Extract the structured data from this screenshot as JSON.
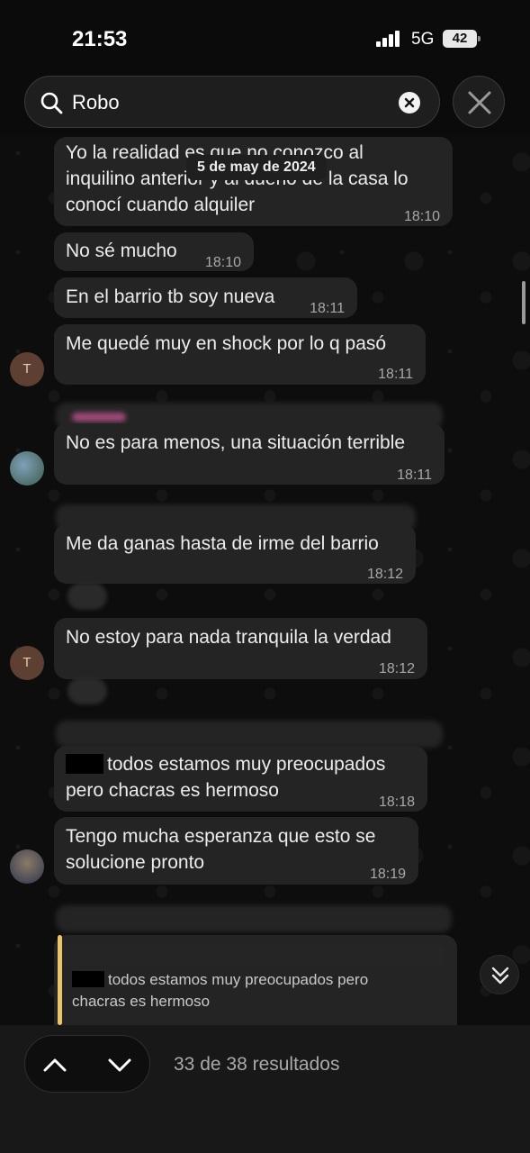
{
  "status": {
    "time": "21:53",
    "network": "5G",
    "battery": "42"
  },
  "search": {
    "query": "Robo"
  },
  "date_pill": "5 de may de 2024",
  "messages": [
    {
      "lines": [
        "Yo la realidad es que no conozco al",
        "inquilino anterior y al dueño de la casa lo",
        "conocí cuando alquiler"
      ],
      "time": "18:10"
    },
    {
      "text": "No sé mucho",
      "time": "18:10"
    },
    {
      "text": "En el barrio tb soy nueva",
      "time": "18:11"
    },
    {
      "text": "Me quedé muy en shock por lo q pasó",
      "time": "18:11",
      "avatar": "T"
    },
    {
      "text": "No es para menos, una situación terrible",
      "time": "18:11"
    },
    {
      "text": "Me da ganas hasta de irme del barrio",
      "time": "18:12"
    },
    {
      "text": "No estoy para nada tranquila la verdad",
      "time": "18:12",
      "avatar": "T"
    },
    {
      "lines": [
        "todos estamos muy preocupados",
        "pero chacras es hermoso"
      ],
      "time": "18:18"
    },
    {
      "lines": [
        "Tengo mucha esperanza que esto se",
        "solucione pronto"
      ],
      "time": "18:19"
    }
  ],
  "quote": {
    "lines": [
      "todos estamos muy preocupados pero",
      "chacras es hermoso"
    ]
  },
  "navigation": {
    "results": "33 de 38 resultados"
  },
  "colors": {
    "bubble": "#242424",
    "quote_bar": "#e9c46a",
    "avatar_t": "#5e4032"
  }
}
